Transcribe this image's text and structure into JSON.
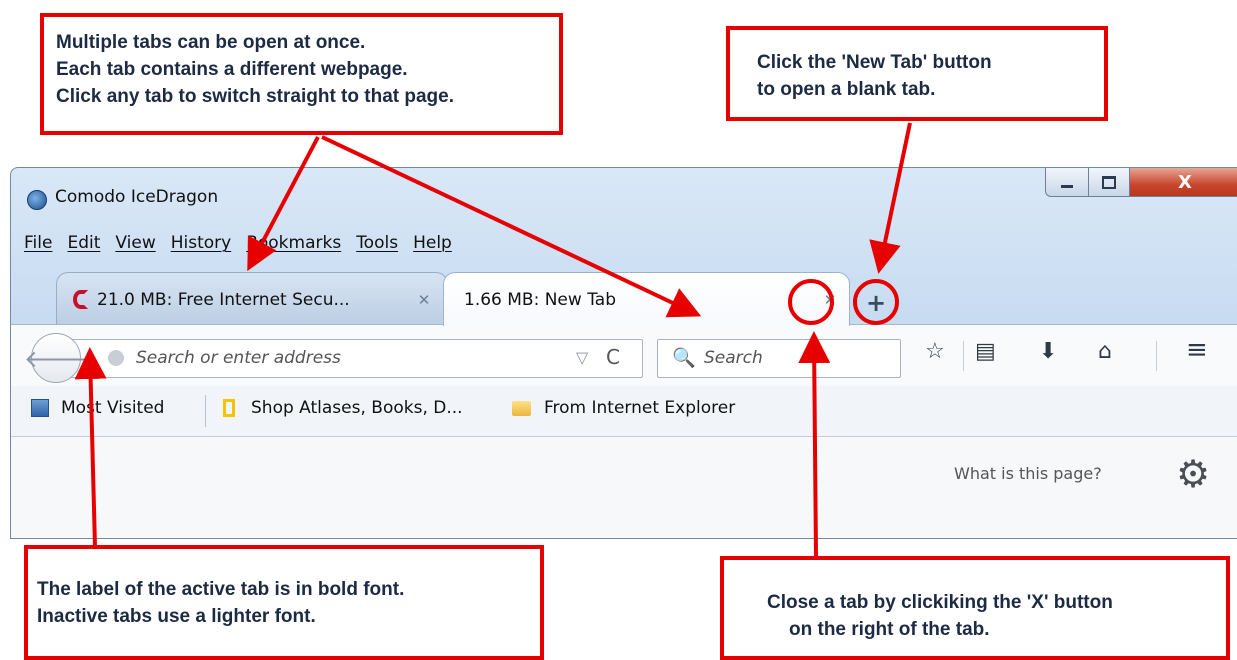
{
  "annotations": {
    "tabs_info": {
      "line1": "Multiple tabs can be open at once.",
      "line2": "Each tab contains a different webpage.",
      "line3": "Click any tab to switch straight to that page."
    },
    "new_tab_info": {
      "line1": "Click the 'New Tab' button",
      "line2": "to open a blank tab."
    },
    "active_tab_info": {
      "line1": "The label of the active tab is in bold font.",
      "line2": "Inactive tabs use a lighter font."
    },
    "close_tab_info": {
      "line1": "Close a tab by clickiking the 'X' button",
      "line2": "on the right of the tab."
    },
    "accent_color": "#e60000"
  },
  "window": {
    "title": "Comodo IceDragon",
    "close_glyph": "X"
  },
  "menu": [
    "File",
    "Edit",
    "View",
    "History",
    "Bookmarks",
    "Tools",
    "Help"
  ],
  "tabs": [
    {
      "label": "21.0 MB: Free Internet Secu...",
      "close": "✕",
      "active": false,
      "icon": "comodo-icon"
    },
    {
      "label": "1.66 MB: New Tab",
      "close": "✕",
      "active": true
    }
  ],
  "new_tab_glyph": "+",
  "navbar": {
    "address_placeholder": "Search or enter address",
    "search_placeholder": "Search",
    "back_glyph": "🡐",
    "dropdown_glyph": "▽",
    "reload_glyph": "C",
    "search_glyph": "🔍",
    "star_glyph": "☆",
    "reading_glyph": "▤",
    "download_glyph": "⬇",
    "home_glyph": "⌂",
    "menu_glyph": "≡"
  },
  "bookmarks": [
    {
      "label": "Most Visited",
      "icon": "most-visited-icon"
    },
    {
      "label": "Shop Atlases, Books, D...",
      "icon": "natgeo-icon"
    },
    {
      "label": "From Internet Explorer",
      "icon": "folder-icon"
    }
  ],
  "content": {
    "help_link": "What is this page?",
    "gear_glyph": "⚙"
  }
}
